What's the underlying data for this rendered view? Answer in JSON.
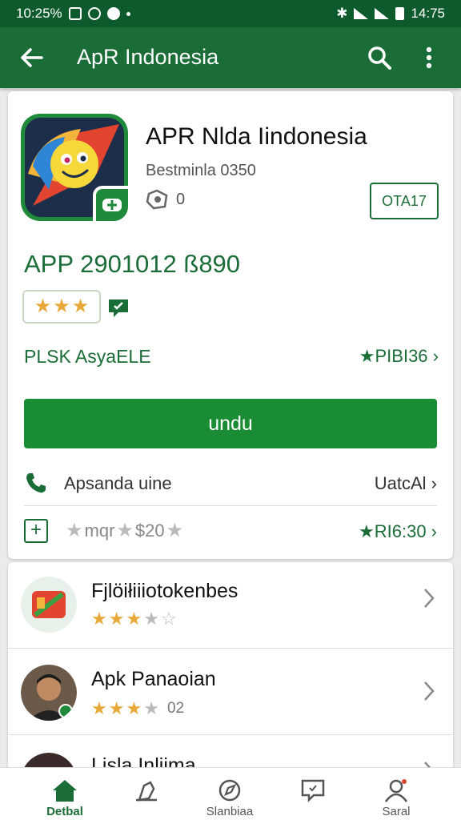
{
  "status_bar": {
    "time": "10:25%",
    "right_time": "14:75"
  },
  "app_bar": {
    "title": "ApR Indonesia"
  },
  "app": {
    "name": "APR Nlda Iindonesia",
    "developer": "Bestminla 0350",
    "meta_count": "0",
    "tag": "OTA17",
    "price_line": "APP 2901012 ß890",
    "rating_stars": 3,
    "section_label": "PLSK AsyaELE",
    "section_link": "★PIBI36 ›",
    "download_label": "undu",
    "row1_text": "Apsanda uine",
    "row1_right": "UatcAl ›",
    "row2_text": "mqr",
    "row2_price": "$20",
    "row2_right": "★RI6:30 ›",
    "accent": "#1b6d37"
  },
  "list": [
    {
      "title": "Fjlöiłiiiotokenbes",
      "stars": 3,
      "extra": ""
    },
    {
      "title": "Apk Panaoian",
      "stars": 3,
      "extra": "02"
    },
    {
      "title": "Lisla Inliima",
      "stars": 0,
      "extra": ""
    }
  ],
  "bottom_nav": [
    {
      "label": "Detbal",
      "icon": "home-icon",
      "active": true
    },
    {
      "label": "",
      "icon": "pen-icon",
      "active": false
    },
    {
      "label": "Slanbiaa",
      "icon": "compass-icon",
      "active": false
    },
    {
      "label": "",
      "icon": "message-icon",
      "active": false
    },
    {
      "label": "Saral",
      "icon": "profile-icon",
      "active": false
    }
  ]
}
